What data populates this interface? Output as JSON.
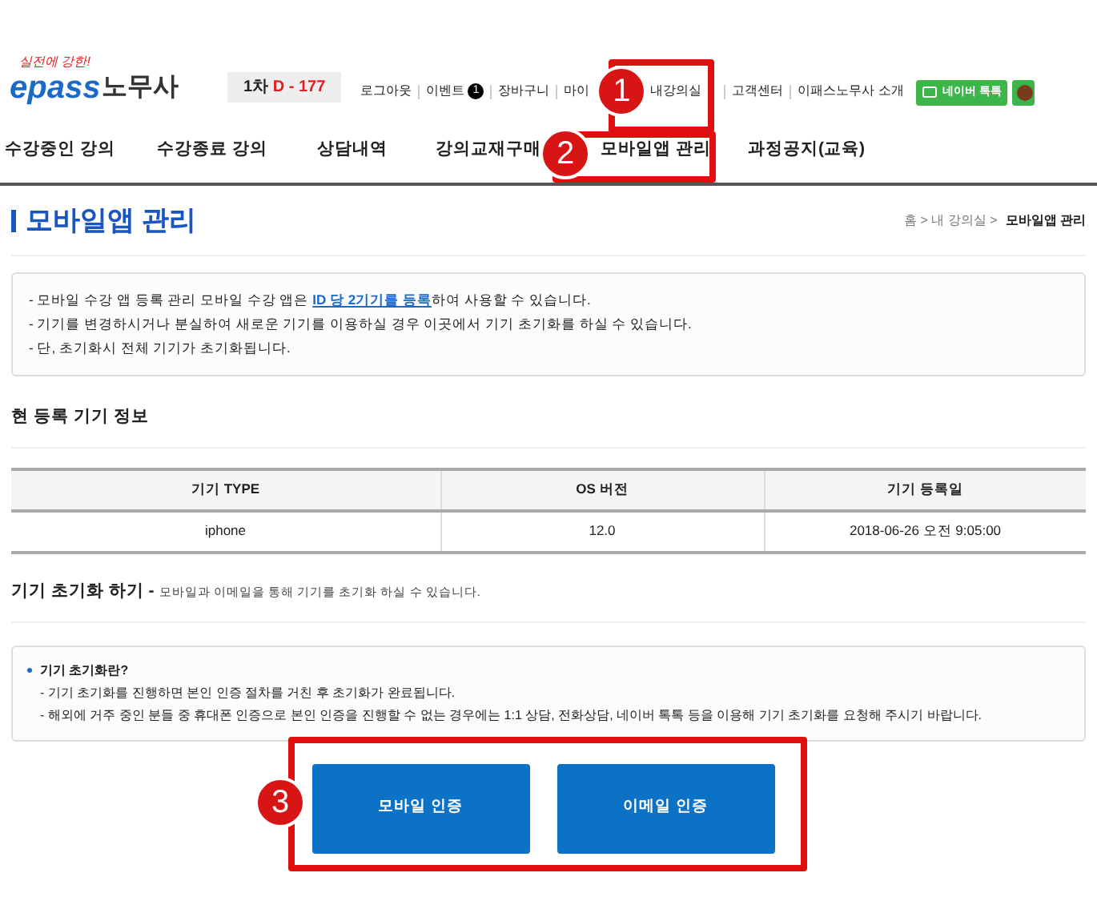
{
  "logo": {
    "tagline": "실전에 강한!",
    "brand": "epass",
    "name": "노무사"
  },
  "dday": {
    "label": "1차",
    "count": "D - 177"
  },
  "top_links": [
    {
      "label": "로그아웃"
    },
    {
      "label": "이벤트",
      "badge": "1"
    },
    {
      "label": "장바구니"
    },
    {
      "label": "마이"
    },
    {
      "label": "내강의실"
    },
    {
      "label": "고객센터"
    },
    {
      "label": "이패스노무사 소개"
    }
  ],
  "talk_button": "네이버 톡톡",
  "nav": [
    {
      "label": "수강중인 강의"
    },
    {
      "label": "수강종료 강의"
    },
    {
      "label": "상담내역"
    },
    {
      "label": "강의교재구매"
    },
    {
      "label": "모바일앱 관리"
    },
    {
      "label": "과정공지(교육)"
    }
  ],
  "page_title": "모바일앱 관리",
  "breadcrumb": [
    {
      "label": "홈 > 내 강의실 >",
      "current": false
    },
    {
      "label": "모바일앱 관리",
      "current": true
    }
  ],
  "notice": [
    "- 모바일 수강 앱 등록 관리 모바일 수강 앱은 ",
    "ID 당 2기기를 등록",
    "하여 사용할 수 있습니다.",
    "- 기기를 변경하시거나 분실하여 새로운 기기를 이용하실 경우 이곳에서 기기 초기화를 하실 수 있습니다.",
    "- 단, 초기화시 전체 기기가 초기화됩니다."
  ],
  "device_section_title": "현 등록 기기 정보",
  "table": {
    "columns": [
      "기기 TYPE",
      "OS 버전",
      "기기 등록일"
    ],
    "rows": [
      [
        "iphone",
        "12.0",
        "2018-06-26 오전 9:05:00"
      ]
    ]
  },
  "reset_section": {
    "title": "기기 초기화 하기 -",
    "subtitle": "모바일과 이메일을 통해 기기를 초기화 하실 수 있습니다."
  },
  "reset_info": {
    "heading": "기기 초기화란?",
    "lines": [
      "- 기기 초기화를 진행하면 본인 인증 절차를 거친 후 초기화가 완료됩니다.",
      "- 해외에 거주 중인 분들 중 휴대폰 인증으로 본인 인증을 진행할 수 없는 경우에는 1:1 상담, 전화상담, 네이버 톡톡 등을 이용해 기기 초기화를 요청해 주시기 바랍니다."
    ]
  },
  "buttons": [
    "모바일 인증",
    "이메일 인증"
  ],
  "annotations": [
    {
      "label": "1"
    },
    {
      "label": "2"
    },
    {
      "label": "3"
    }
  ]
}
